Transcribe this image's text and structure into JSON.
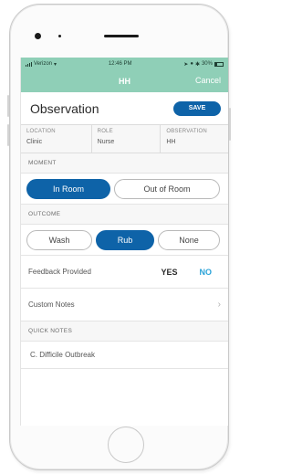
{
  "status_bar": {
    "carrier": "Verizon",
    "time": "12:46 PM",
    "battery": "30%"
  },
  "nav": {
    "title": "HH",
    "cancel_label": "Cancel"
  },
  "header": {
    "title": "Observation",
    "save_label": "SAVE"
  },
  "info": [
    {
      "label": "LOCATION",
      "value": "Clinic"
    },
    {
      "label": "ROLE",
      "value": "Nurse"
    },
    {
      "label": "OBSERVATION",
      "value": "HH"
    }
  ],
  "moment": {
    "label": "MOMENT",
    "options": [
      "In Room",
      "Out of Room"
    ],
    "selected": "In Room"
  },
  "outcome": {
    "label": "OUTCOME",
    "options": [
      "Wash",
      "Rub",
      "None"
    ],
    "selected": "Rub"
  },
  "feedback": {
    "label": "Feedback Provided",
    "yes": "YES",
    "no": "NO",
    "selected": "NO"
  },
  "custom_notes": {
    "label": "Custom Notes"
  },
  "quick_notes": {
    "label": "QUICK NOTES",
    "items": [
      "C. Difficile Outbreak"
    ]
  },
  "colors": {
    "accent": "#0e63a8",
    "nav": "#8fcfb7",
    "link": "#2ba3d8"
  }
}
